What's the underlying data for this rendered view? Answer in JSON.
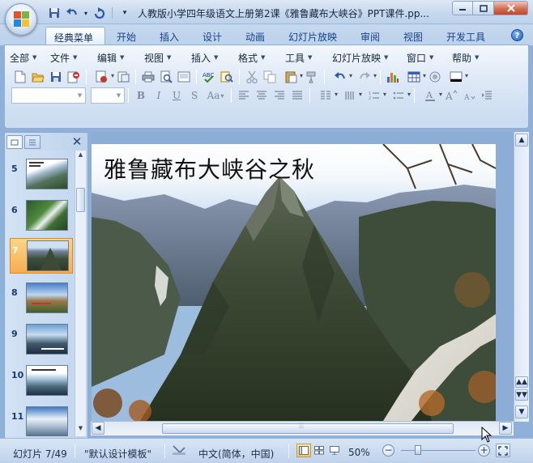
{
  "window": {
    "title": "人教版小学四年级语文上册第2课《雅鲁藏布大峡谷》PPT课件.pp...",
    "quick_access": [
      "save-icon",
      "undo-icon",
      "redo-icon",
      "customize-icon"
    ]
  },
  "ribbon_tabs": [
    {
      "label": "经典菜单",
      "active": true
    },
    {
      "label": "开始"
    },
    {
      "label": "插入"
    },
    {
      "label": "设计"
    },
    {
      "label": "动画"
    },
    {
      "label": "幻灯片放映"
    },
    {
      "label": "审阅"
    },
    {
      "label": "视图"
    },
    {
      "label": "开发工具"
    }
  ],
  "menus": [
    "全部",
    "文件",
    "编辑",
    "视图",
    "插入",
    "格式",
    "工具",
    "幻灯片放映",
    "窗口",
    "帮助"
  ],
  "format_buttons": [
    "B",
    "I",
    "U",
    "S",
    "Aa"
  ],
  "slides_panel": {
    "items": [
      {
        "number": "5"
      },
      {
        "number": "6"
      },
      {
        "number": "7",
        "selected": true
      },
      {
        "number": "8"
      },
      {
        "number": "9"
      },
      {
        "number": "10"
      },
      {
        "number": "11"
      }
    ]
  },
  "slide": {
    "title": "雅鲁藏布大峡谷之秋"
  },
  "status": {
    "slide_info": "幻灯片 7/49",
    "theme": "\"默认设计模板\"",
    "language": "中文(简体，中国)",
    "zoom": "50%",
    "zoom_level": 0.5
  },
  "colors": {
    "accent": "#15428b",
    "selected_slide": "#f7ad4f",
    "ribbon": "#dde8f6"
  }
}
